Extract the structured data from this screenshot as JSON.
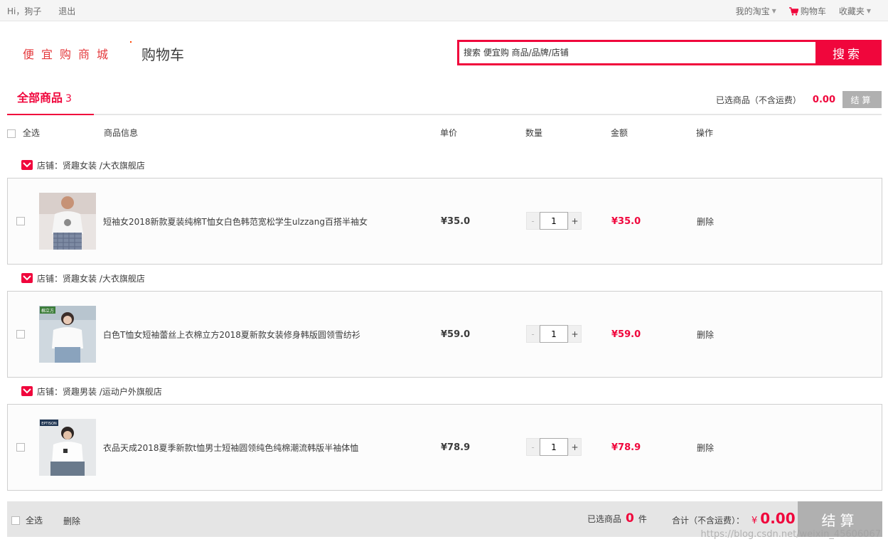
{
  "topbar": {
    "greeting": "Hi，狗子",
    "logout": "退出",
    "my_taobao": "我的淘宝",
    "cart": "购物车",
    "favorites": "收藏夹"
  },
  "header": {
    "logo": "便宜购商城",
    "title": "购物车",
    "search_placeholder": "搜索 便宜购 商品/品牌/店铺",
    "search_button": "搜索"
  },
  "tabs": {
    "all_label": "全部商品",
    "all_count": "3"
  },
  "summary_top": {
    "label": "已选商品（不含运费）",
    "amount": "0.00",
    "checkout": "结算"
  },
  "columns": {
    "select_all": "全选",
    "info": "商品信息",
    "unit_price": "单价",
    "quantity": "数量",
    "amount": "金额",
    "action": "操作"
  },
  "items": [
    {
      "shop": "店铺：贤趣女装 /大衣旗舰店",
      "title": "短袖女2018新款夏装纯棉T恤女白色韩范宽松学生ulzzang百搭半袖女",
      "price": "¥35.0",
      "quantity": "1",
      "subtotal": "¥35.0",
      "delete": "删除"
    },
    {
      "shop": "店铺：贤趣女装 /大衣旗舰店",
      "title": "白色T恤女短袖蕾丝上衣棉立方2018夏新款女装修身韩版圆领雪纺衫",
      "price": "¥59.0",
      "quantity": "1",
      "subtotal": "¥59.0",
      "delete": "删除",
      "thumb_tag": "棉立方"
    },
    {
      "shop": "店铺：贤趣男装 /运动户外旗舰店",
      "title": "衣品天成2018夏季新款t恤男士短袖圆领纯色纯棉潮流韩版半袖体恤",
      "price": "¥78.9",
      "quantity": "1",
      "subtotal": "¥78.9",
      "delete": "删除",
      "thumb_tag": "EPTISON"
    }
  ],
  "footer": {
    "select_all": "全选",
    "delete": "删除",
    "selected_prefix": "已选商品",
    "selected_count": "0",
    "selected_unit": "件",
    "total_label": "合计（不含运费）：",
    "currency": "¥",
    "total": "0.00",
    "checkout": "结算"
  },
  "watermark": "https://blog.csdn.net/weixin_45606067",
  "colors": {
    "accent": "#f0063c",
    "checkout_disabled": "#b0b0b0"
  }
}
